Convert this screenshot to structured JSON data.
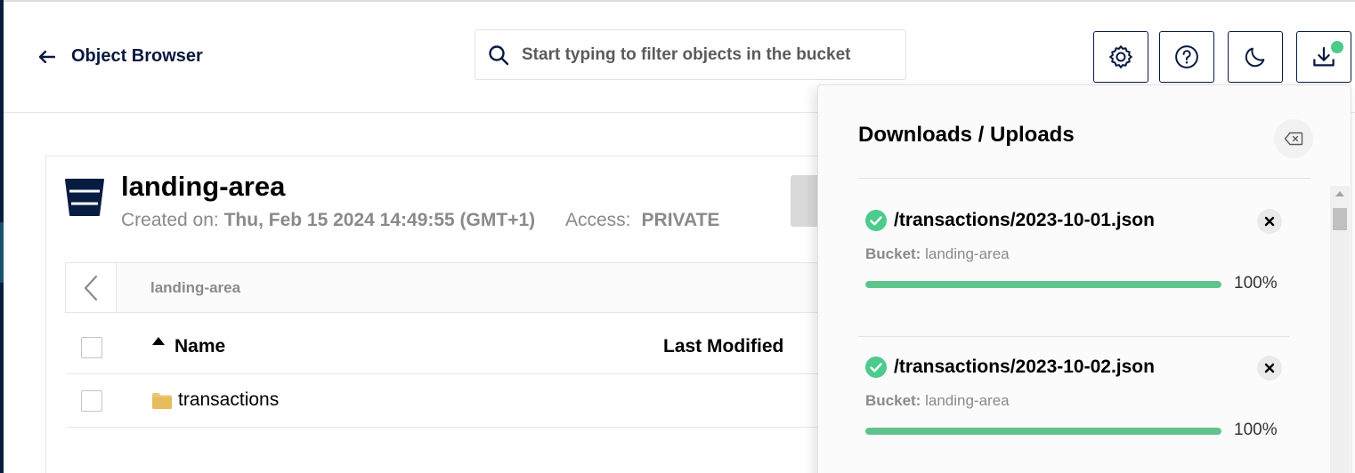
{
  "header": {
    "back_label": "Object Browser",
    "search_placeholder": "Start typing to filter objects in the bucket",
    "buttons": [
      "settings",
      "help",
      "dark-mode",
      "downloads"
    ]
  },
  "bucket": {
    "name": "landing-area",
    "created_label": "Created on:",
    "created_value": "Thu, Feb 15 2024 14:49:55 (GMT+1)",
    "access_label": "Access:",
    "access_value": "PRIVATE"
  },
  "breadcrumb": {
    "path": "landing-area"
  },
  "table": {
    "columns": [
      "Name",
      "Last Modified"
    ],
    "rows": [
      {
        "name": "transactions",
        "type": "folder"
      }
    ]
  },
  "downloads_panel": {
    "title": "Downloads / Uploads",
    "items": [
      {
        "file": "/transactions/2023-10-01.json",
        "bucket_label": "Bucket:",
        "bucket": "landing-area",
        "progress": 1.0,
        "progress_text": "100%"
      },
      {
        "file": "/transactions/2023-10-02.json",
        "bucket_label": "Bucket:",
        "bucket": "landing-area",
        "progress": 1.0,
        "progress_text": "100%"
      }
    ]
  },
  "colors": {
    "navy": "#081c42",
    "success": "#4ccb8d",
    "progress": "#5fc48c",
    "muted": "#8a8a8a"
  }
}
